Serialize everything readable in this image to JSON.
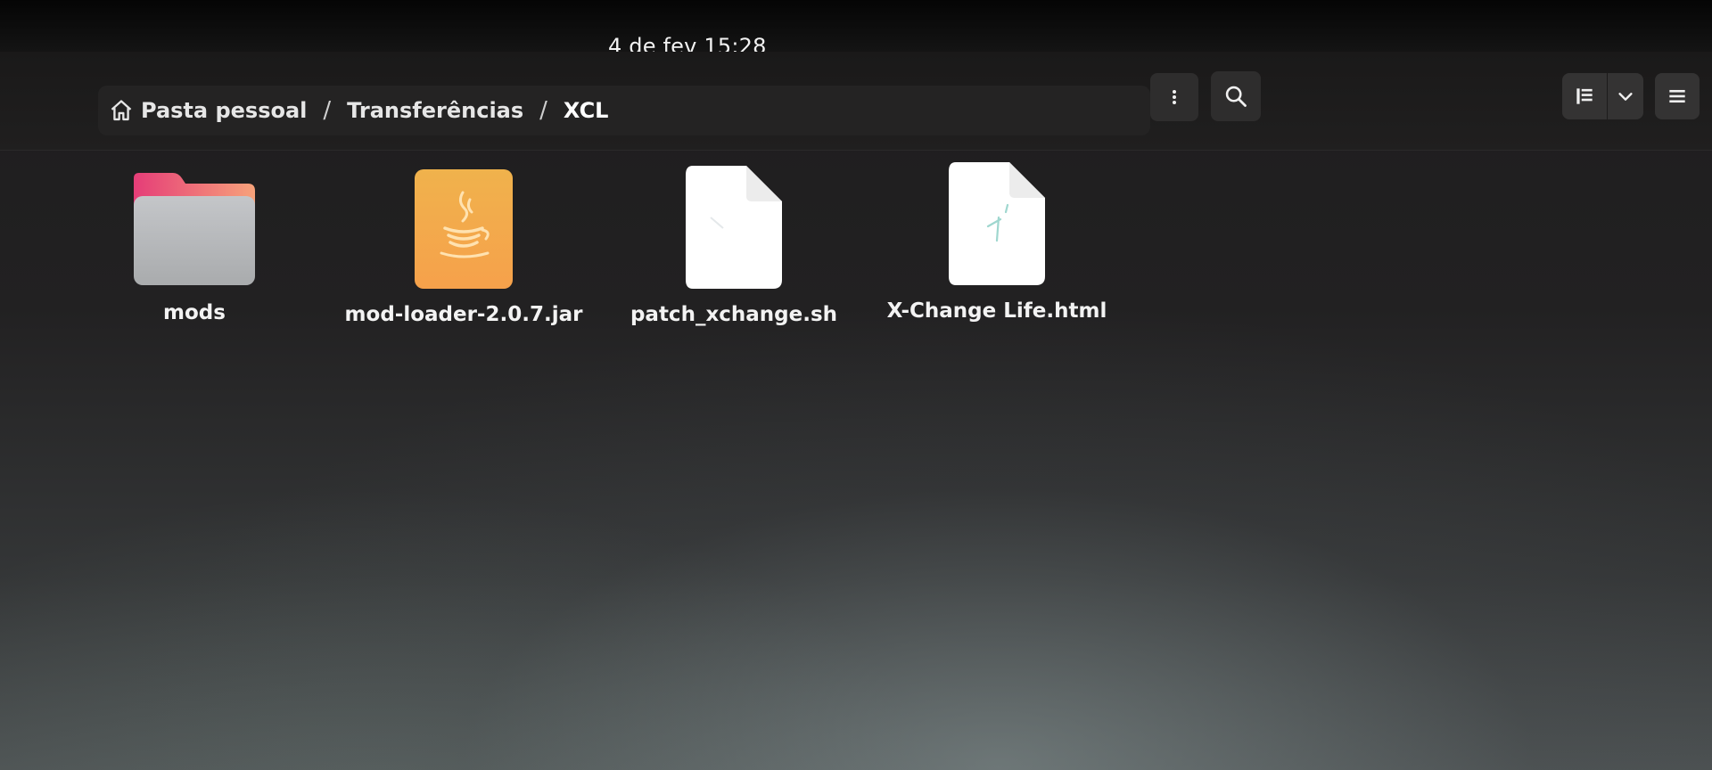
{
  "topbar": {
    "clock": "4 de fev  15:28"
  },
  "pathbar": {
    "crumbs": [
      {
        "label": "Pasta pessoal",
        "icon": "home-icon"
      },
      {
        "label": "Transferências"
      },
      {
        "label": "XCL"
      }
    ],
    "separator": "/"
  },
  "header": {
    "buttons": {
      "menu": "vertical-dots-icon",
      "search": "search-icon",
      "view": "list-view-icon",
      "view_options": "chevron-down-icon",
      "main_menu": "hamburger-icon"
    }
  },
  "files": [
    {
      "name": "mods",
      "type": "folder"
    },
    {
      "name": "mod-loader-2.0.7.jar",
      "type": "java-archive"
    },
    {
      "name": "patch_xchange.sh",
      "type": "shell-script"
    },
    {
      "name": "X-Change Life.html",
      "type": "html-file"
    }
  ],
  "colors": {
    "folder_tab": "#e8427c",
    "folder_body": "#b9bcbf",
    "jar": "#f3a94a",
    "document": "#ffffff"
  }
}
